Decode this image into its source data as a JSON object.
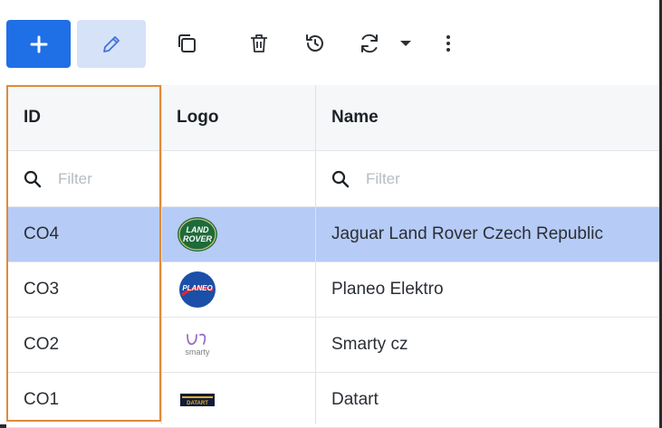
{
  "toolbar": {
    "add_icon": "plus-icon",
    "edit_icon": "pencil-icon",
    "copy_icon": "copy-icon",
    "delete_icon": "trash-icon",
    "history_icon": "history-icon",
    "refresh_icon": "refresh-icon",
    "dropdown_icon": "caret-down-icon",
    "more_icon": "more-vertical-icon"
  },
  "grid": {
    "columns": [
      {
        "key": "id",
        "label": "ID"
      },
      {
        "key": "logo",
        "label": "Logo"
      },
      {
        "key": "name",
        "label": "Name"
      }
    ],
    "filters": {
      "id": {
        "value": "",
        "placeholder": "Filter"
      },
      "name": {
        "value": "",
        "placeholder": "Filter"
      }
    },
    "rows": [
      {
        "id": "CO4",
        "name": "Jaguar Land Rover Czech Republic",
        "logo": "land-rover-logo",
        "logo_text": "LAND ROVER",
        "selected": true
      },
      {
        "id": "CO3",
        "name": "Planeo Elektro",
        "logo": "planeo-logo",
        "logo_text": "PLANEO",
        "selected": false
      },
      {
        "id": "CO2",
        "name": "Smarty cz",
        "logo": "smarty-logo",
        "logo_text": "smarty",
        "selected": false
      },
      {
        "id": "CO1",
        "name": "Datart",
        "logo": "datart-logo",
        "logo_text": "DATART",
        "selected": false
      }
    ]
  },
  "colors": {
    "primary": "#1f6fe6",
    "edit_bg": "#d6e2f8",
    "selected_row": "#b6cbf6",
    "highlight_outline": "#e08a3a"
  }
}
